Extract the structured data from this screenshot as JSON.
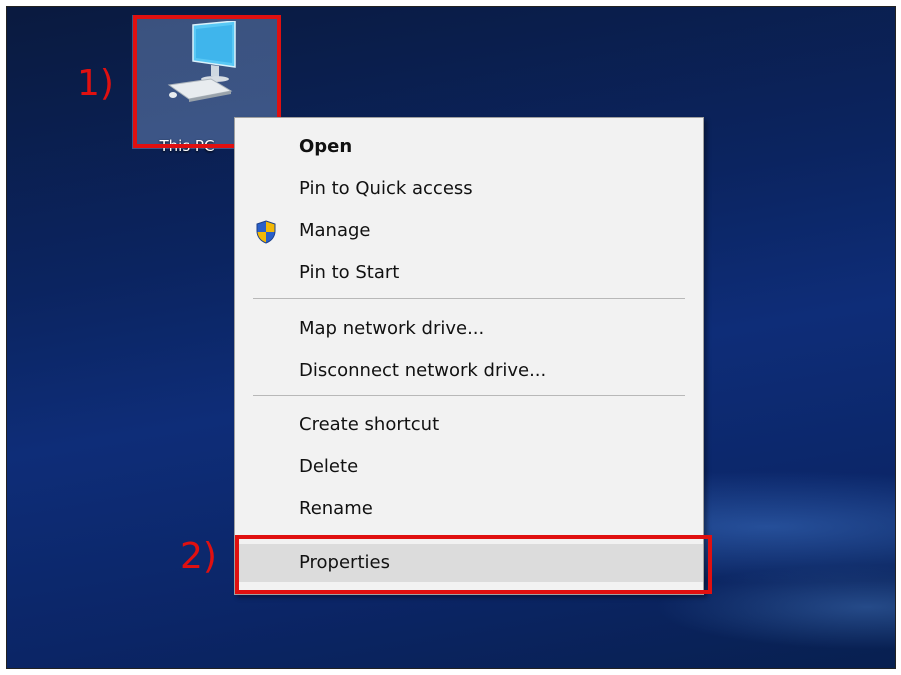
{
  "desktop": {
    "icon": {
      "label": "This PC",
      "icon": "computer-icon"
    }
  },
  "annotations": {
    "step1": "1)",
    "step2": "2)",
    "highlight_color": "#e01010"
  },
  "context_menu": {
    "groups": [
      [
        {
          "label": "Open",
          "bold": true
        },
        {
          "label": "Pin to Quick access"
        },
        {
          "label": "Manage",
          "icon": "uac-shield-icon"
        },
        {
          "label": "Pin to Start"
        }
      ],
      [
        {
          "label": "Map network drive..."
        },
        {
          "label": "Disconnect network drive..."
        }
      ],
      [
        {
          "label": "Create shortcut"
        },
        {
          "label": "Delete"
        },
        {
          "label": "Rename"
        }
      ],
      [
        {
          "label": "Properties",
          "highlighted": true
        }
      ]
    ]
  }
}
